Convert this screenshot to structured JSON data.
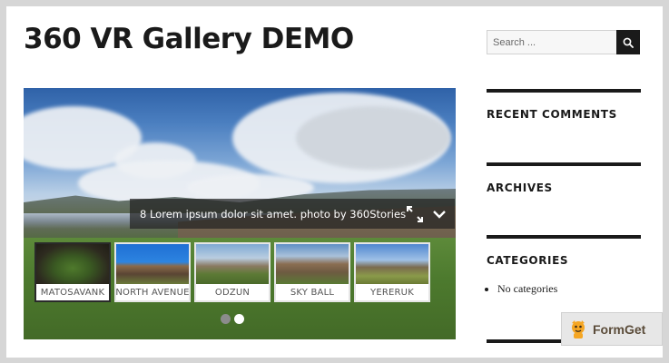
{
  "site": {
    "title": "360 VR Gallery DEMO"
  },
  "search": {
    "placeholder": "Search ..."
  },
  "widgets": [
    {
      "title": "RECENT COMMENTS"
    },
    {
      "title": "ARCHIVES"
    },
    {
      "title": "CATEGORIES",
      "items": [
        "No categories"
      ]
    }
  ],
  "gallery": {
    "caption": "8 Lorem ipsum dolor sit amet. photo by 360Stories",
    "thumbnails": [
      {
        "label": "MATOSAVANK",
        "active": true
      },
      {
        "label": "NORTH AVENUE",
        "active": false
      },
      {
        "label": "ODZUN",
        "active": false
      },
      {
        "label": "SKY BALL",
        "active": false
      },
      {
        "label": "YERERUK",
        "active": false
      }
    ],
    "pagination": {
      "pages": 2,
      "current": 2
    }
  },
  "badge": {
    "text": "FormGet"
  },
  "colors": {
    "accent": "#1a1a1a",
    "badge_text": "#5b4c3a",
    "badge_logo": "#f5a623"
  },
  "icons": {
    "search": "search-icon",
    "fullscreen": "expand-icon",
    "toggle": "chevron-down-icon"
  }
}
